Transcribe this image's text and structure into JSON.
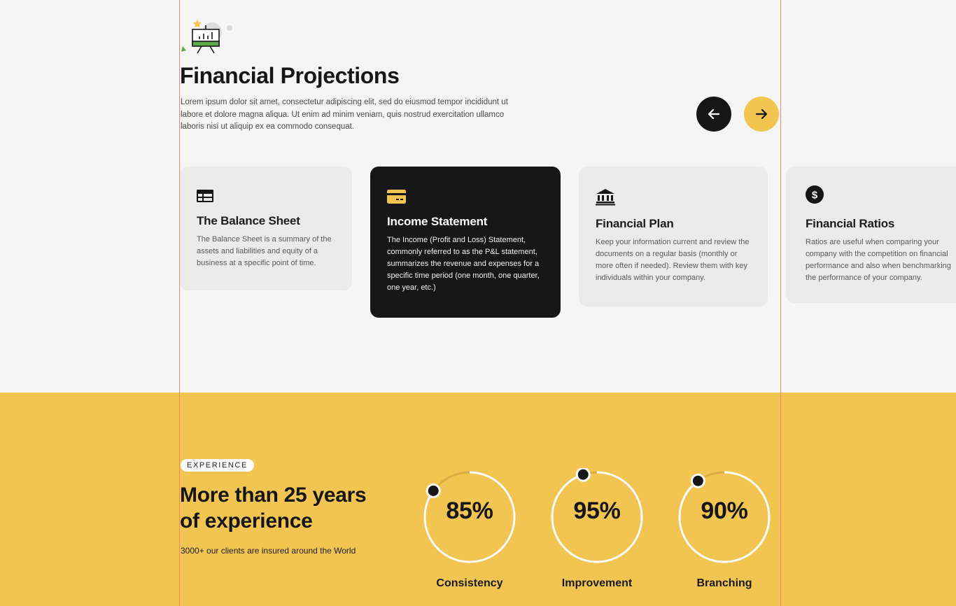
{
  "hero": {
    "title": "Financial Projections",
    "description": "Lorem ipsum dolor sit amet, consectetur adipiscing elit, sed do eiusmod tempor incididunt ut labore et dolore magna aliqua. Ut enim ad minim veniam, quis nostrud exercitation ullamco laboris nisi ut aliquip ex ea commodo consequat.",
    "icon": "presentation-board-icon",
    "nav": {
      "prev_icon": "arrow-left-icon",
      "next_icon": "arrow-right-icon"
    }
  },
  "cards": [
    {
      "icon": "table-icon",
      "title": "The Balance Sheet",
      "text": "The Balance Sheet is a summary of the assets and liabilities and equity of a business at a specific point of time."
    },
    {
      "icon": "credit-card-icon",
      "title": "Income Statement",
      "text": "The Income (Profit and Loss) Statement, commonly referred to as the P&L statement, summarizes the revenue and expenses for a specific time period (one month, one quarter, one year, etc.)"
    },
    {
      "icon": "bank-icon",
      "title": "Financial Plan",
      "text": "Keep your information current and review the documents on a regular basis (monthly or more often if needed). Review them with key individuals within your company."
    },
    {
      "icon": "dollar-circle-icon",
      "title": "Financial Ratios",
      "text": "Ratios are useful when comparing your company with the competition on financial performance and also when benchmarking the performance of your company."
    }
  ],
  "experience": {
    "badge": "EXPERIENCE",
    "title": "More than 25 years of experience",
    "subtitle": "3000+ our clients are insured around the World",
    "stats": [
      {
        "value": "85%",
        "label": "Consistency",
        "fraction": 0.85
      },
      {
        "value": "95%",
        "label": "Improvement",
        "fraction": 0.95
      },
      {
        "value": "90%",
        "label": "Branching",
        "fraction": 0.9
      }
    ]
  },
  "colors": {
    "accent": "#f2c452",
    "dark": "#171717",
    "light": "#f5f5f5",
    "card": "#ebebeb"
  }
}
